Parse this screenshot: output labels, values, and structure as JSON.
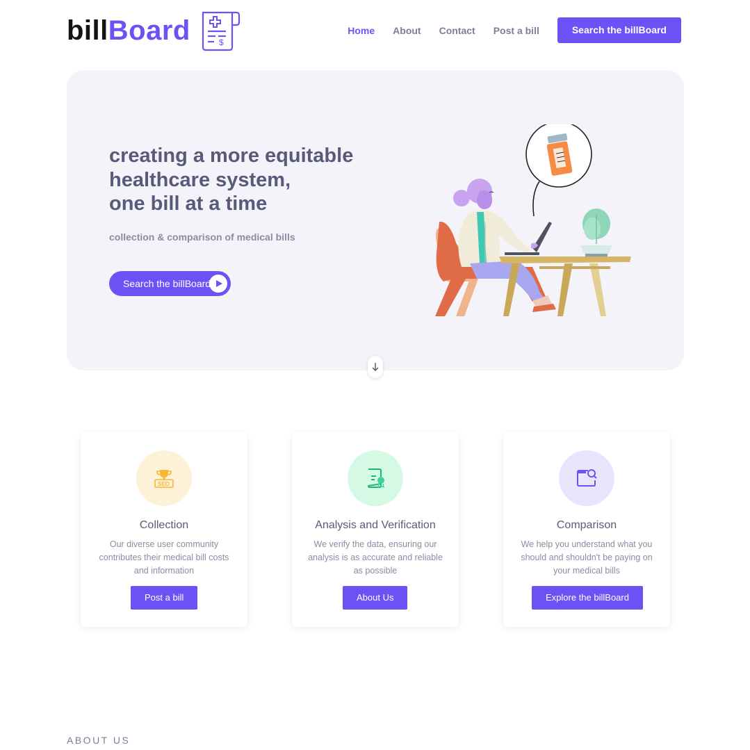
{
  "brand": {
    "name_part1": "bill",
    "name_part2": "Board",
    "logo_icon": "medical-bill-icon",
    "color_dark": "#141414",
    "color_accent": "#6b52f5"
  },
  "nav": {
    "items": [
      {
        "label": "Home",
        "active": true
      },
      {
        "label": "About",
        "active": false
      },
      {
        "label": "Contact",
        "active": false
      },
      {
        "label": "Post a bill",
        "active": false
      }
    ],
    "cta_label": "Search the billBoard"
  },
  "hero": {
    "title_lines": [
      "creating a more equitable",
      "healthcare system,",
      "one bill at a time"
    ],
    "subtitle": "collection & comparison of medical bills",
    "button_label": "Search the billBoard",
    "button_icon": "play-icon",
    "illustration": "woman-at-laptop-illustration",
    "background": "#f4f3fa"
  },
  "scroll_icon": "arrow-down-icon",
  "features": [
    {
      "icon": "trophy-seo-icon",
      "icon_bg": "#fdf1d8",
      "title": "Collection",
      "description": "Our diverse user community contributes their medical bill costs and information",
      "button_label": "Post a bill"
    },
    {
      "icon": "verified-document-icon",
      "icon_bg": "#d4fae6",
      "title": "Analysis and Verification",
      "description": "We verify the data, ensuring our analysis is as accurate and reliable as possible",
      "button_label": "About Us"
    },
    {
      "icon": "window-search-icon",
      "icon_bg": "#e9e5fd",
      "title": "Comparison",
      "description": "We help you understand what you should and shouldn't be paying on your medical bills",
      "button_label": "Explore the billBoard"
    }
  ],
  "about_section": {
    "label": "ABOUT US"
  }
}
